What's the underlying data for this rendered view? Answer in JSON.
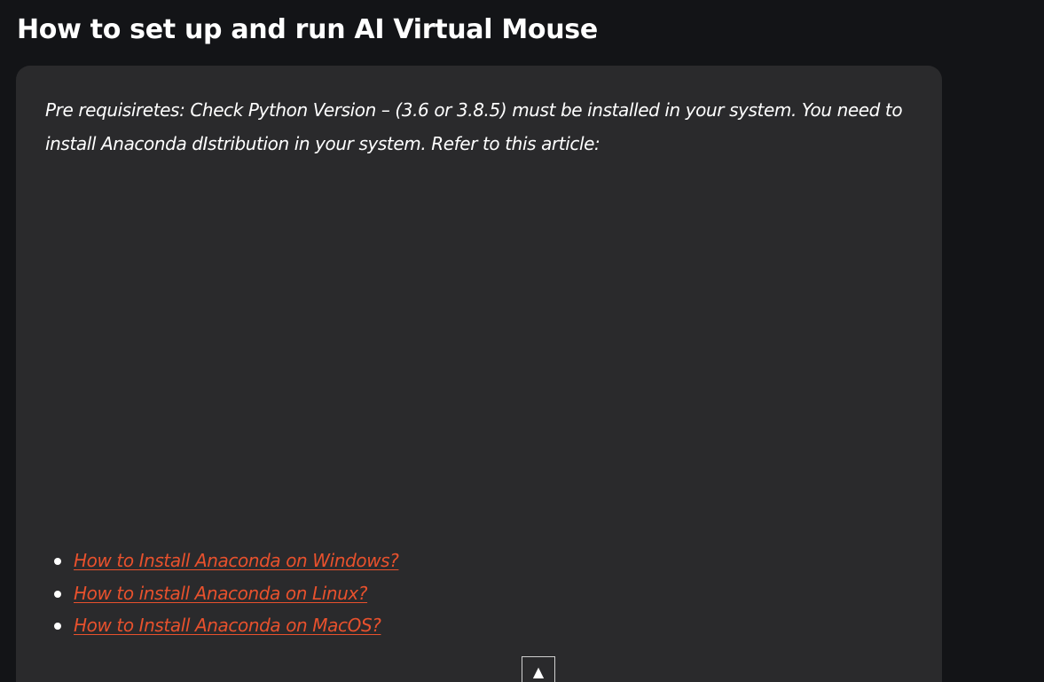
{
  "article": {
    "heading": "How to set up and run AI Virtual Mouse",
    "intro": "Pre requisiretes: Check Python Version – (3.6 or 3.8.5) must be installed in your system. You need to install Anaconda dIstribution in your system. Refer to this article:",
    "links": [
      {
        "label": "How to Install Anaconda on Windows?"
      },
      {
        "label": "How to install Anaconda on Linux?"
      },
      {
        "label": "How to Install Anaconda on MacOS?"
      }
    ]
  },
  "controls": {
    "scroll_top_glyph": "▲"
  },
  "colors": {
    "page_background": "#131417",
    "card_background": "#2a2a2c",
    "link": "#e8512d",
    "text": "#ffffff"
  }
}
